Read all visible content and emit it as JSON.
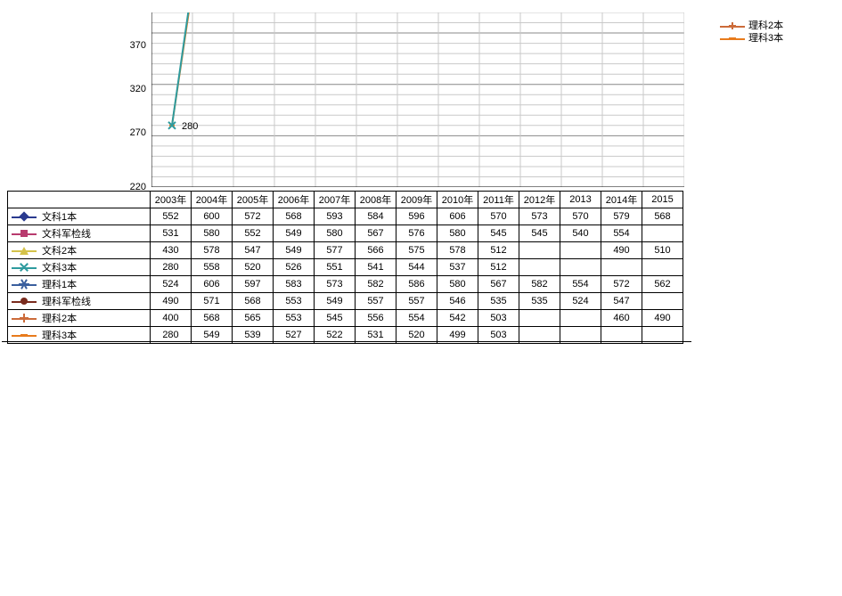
{
  "chart_data": {
    "type": "line",
    "title": "",
    "xlabel": "",
    "ylabel": "",
    "ylim": [
      220,
      390
    ],
    "yticks": [
      220,
      270,
      320,
      370
    ],
    "categories": [
      "2003年",
      "2004年",
      "2005年",
      "2006年",
      "2007年",
      "2008年",
      "2009年",
      "2010年",
      "2011年",
      "2012年",
      "2013",
      "2014年",
      "2015"
    ],
    "visible_portion_note": "Only the lower tail of the chart (y≈220–390) is shown; most line values lie above the visible plot area. The data table below carries the full values.",
    "series": [
      {
        "name": "文科1本",
        "color": "#2a3a8f",
        "marker": "diamond",
        "values": [
          552,
          600,
          572,
          568,
          593,
          584,
          596,
          606,
          570,
          573,
          570,
          579,
          568
        ]
      },
      {
        "name": "文科军检线",
        "color": "#b83b6e",
        "marker": "square",
        "values": [
          531,
          580,
          552,
          549,
          580,
          567,
          576,
          580,
          545,
          545,
          540,
          554,
          ""
        ]
      },
      {
        "name": "文科2本",
        "color": "#d4c24a",
        "marker": "triangle",
        "values": [
          430,
          578,
          547,
          549,
          577,
          566,
          575,
          578,
          512,
          "",
          "",
          490,
          510
        ]
      },
      {
        "name": "文科3本",
        "color": "#2e9b9e",
        "marker": "x",
        "values": [
          280,
          558,
          520,
          526,
          551,
          541,
          544,
          537,
          512,
          "",
          "",
          "",
          ""
        ]
      },
      {
        "name": "理科1本",
        "color": "#3a5f9e",
        "marker": "star",
        "values": [
          524,
          606,
          597,
          583,
          573,
          582,
          586,
          580,
          567,
          582,
          554,
          572,
          562
        ]
      },
      {
        "name": "理科军检线",
        "color": "#7a2c1e",
        "marker": "circle",
        "values": [
          490,
          571,
          568,
          553,
          549,
          557,
          557,
          546,
          535,
          535,
          524,
          547,
          ""
        ]
      },
      {
        "name": "理科2本",
        "color": "#cc6b3a",
        "marker": "plus",
        "values": [
          400,
          568,
          565,
          553,
          545,
          556,
          554,
          542,
          503,
          "",
          "",
          460,
          490
        ]
      },
      {
        "name": "理科3本",
        "color": "#e87b1c",
        "marker": "dash",
        "values": [
          280,
          549,
          539,
          527,
          522,
          531,
          520,
          499,
          503,
          "",
          "",
          "",
          ""
        ]
      }
    ],
    "visible_series_legend_right": [
      {
        "name": "理科2本",
        "marker": "plus",
        "color": "#cc6b3a"
      },
      {
        "name": "理科3本",
        "marker": "dash",
        "color": "#e87b1c"
      }
    ],
    "visible_point_label": {
      "series": "理科3本",
      "category": "2003年",
      "value": 280
    }
  }
}
